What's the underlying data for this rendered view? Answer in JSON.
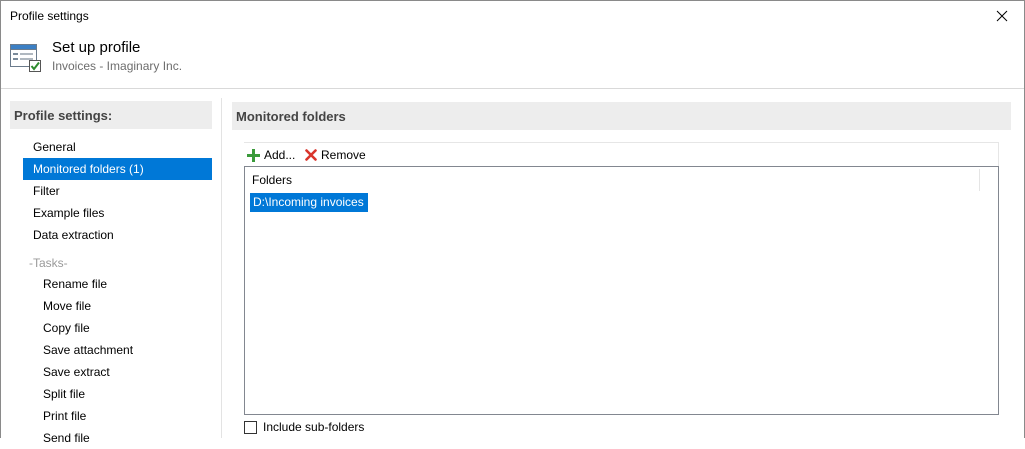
{
  "window": {
    "title": "Profile settings",
    "close_icon": "close-icon"
  },
  "header": {
    "title": "Set up profile",
    "subtitle": "Invoices - Imaginary Inc.",
    "icon": "profile-settings-icon"
  },
  "sidebar": {
    "heading": "Profile settings:",
    "items": [
      {
        "label": "General",
        "selected": false
      },
      {
        "label": "Monitored folders (1)",
        "selected": true
      },
      {
        "label": "Filter",
        "selected": false
      },
      {
        "label": "Example files",
        "selected": false
      },
      {
        "label": "Data extraction",
        "selected": false
      }
    ],
    "tasks_group_label": "-Tasks-",
    "tasks": [
      {
        "label": "Rename file"
      },
      {
        "label": "Move file"
      },
      {
        "label": "Copy file"
      },
      {
        "label": "Save attachment"
      },
      {
        "label": "Save extract"
      },
      {
        "label": "Split file"
      },
      {
        "label": "Print file"
      },
      {
        "label": "Send file"
      }
    ]
  },
  "main": {
    "heading": "Monitored folders",
    "toolbar": {
      "add_label": "Add...",
      "add_icon": "plus-icon",
      "remove_label": "Remove",
      "remove_icon": "x-icon"
    },
    "list": {
      "column_header": "Folders",
      "rows": [
        {
          "path": "D:\\Incoming invoices",
          "selected": true
        }
      ]
    },
    "include_subfolders": {
      "label": "Include sub-folders",
      "checked": false
    }
  },
  "colors": {
    "selection": "#0078d7",
    "section_header_bg": "#ededed",
    "add_icon": "#3a9a3a",
    "remove_icon": "#d9342b"
  }
}
